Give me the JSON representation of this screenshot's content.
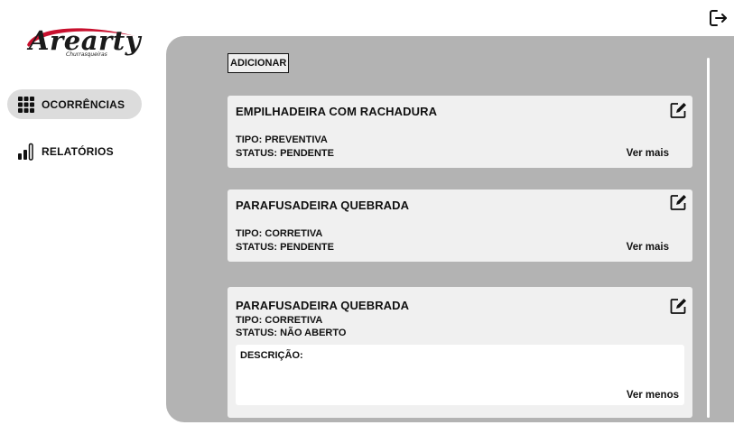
{
  "logo": {
    "text": "Arearty",
    "subtitle": "Churrasqueiras"
  },
  "sidebar": {
    "items": [
      {
        "label": "OCORRÊNCIAS",
        "icon": "grid-icon",
        "active": true
      },
      {
        "label": "RELATÓRIOS",
        "icon": "bar-chart-icon",
        "active": false
      }
    ]
  },
  "header": {
    "logout_icon": "logout-icon"
  },
  "main": {
    "add_label": "ADICIONAR",
    "cards": [
      {
        "title": "EMPILHADEIRA COM RACHADURA",
        "tipo": "TIPO: PREVENTIVA",
        "status": "STATUS: PENDENTE",
        "toggle": "Ver mais"
      },
      {
        "title": "PARAFUSADEIRA QUEBRADA",
        "tipo": "TIPO: CORRETIVA",
        "status": "STATUS: PENDENTE",
        "toggle": "Ver mais"
      },
      {
        "title": "PARAFUSADEIRA QUEBRADA",
        "tipo": "TIPO: CORRETIVA",
        "status": "STATUS: NÃO ABERTO",
        "description_label": "DESCRIÇÃO:",
        "toggle": "Ver menos"
      }
    ]
  },
  "colors": {
    "panel": "#b3b3b3",
    "card": "#f0f0f0",
    "active_nav": "#dcdcdc",
    "logo_swoosh": "#c8102e"
  }
}
